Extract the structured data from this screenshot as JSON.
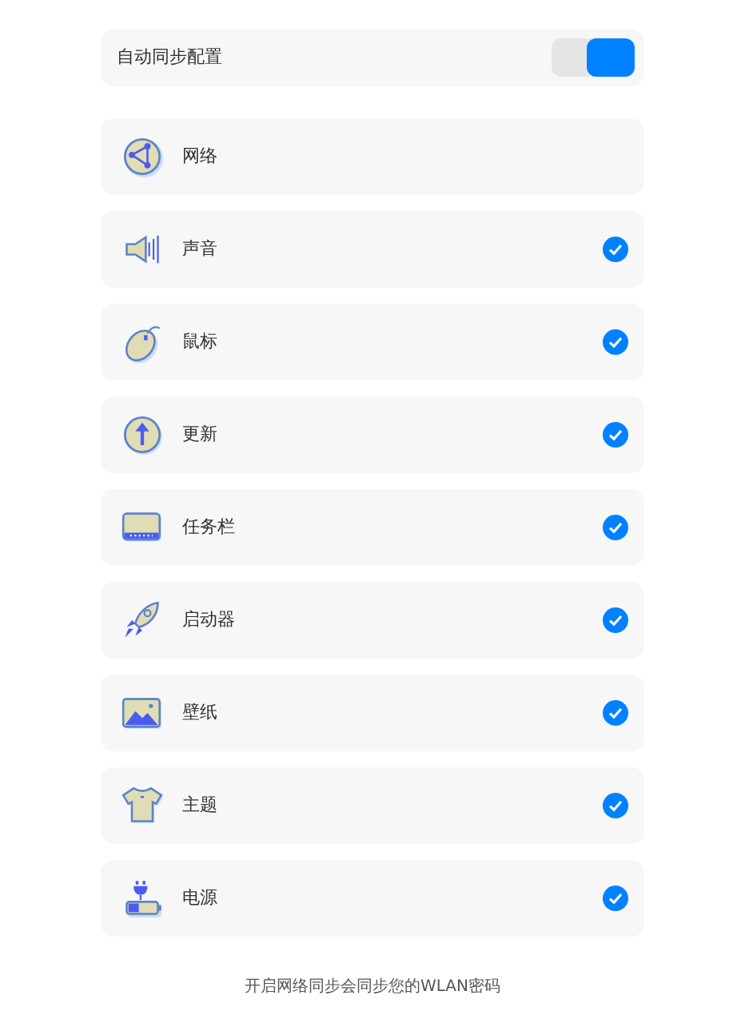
{
  "auto_sync": {
    "label": "自动同步配置",
    "on": true
  },
  "items": [
    {
      "kind": "network",
      "label": "网络",
      "checked": false
    },
    {
      "kind": "sound",
      "label": "声音",
      "checked": true
    },
    {
      "kind": "mouse",
      "label": "鼠标",
      "checked": true
    },
    {
      "kind": "update",
      "label": "更新",
      "checked": true
    },
    {
      "kind": "taskbar",
      "label": "任务栏",
      "checked": true
    },
    {
      "kind": "launcher",
      "label": "启动器",
      "checked": true
    },
    {
      "kind": "wallpaper",
      "label": "壁纸",
      "checked": true
    },
    {
      "kind": "theme",
      "label": "主题",
      "checked": true
    },
    {
      "kind": "power",
      "label": "电源",
      "checked": true
    }
  ],
  "footer_note": "开启网络同步会同步您的WLAN密码"
}
